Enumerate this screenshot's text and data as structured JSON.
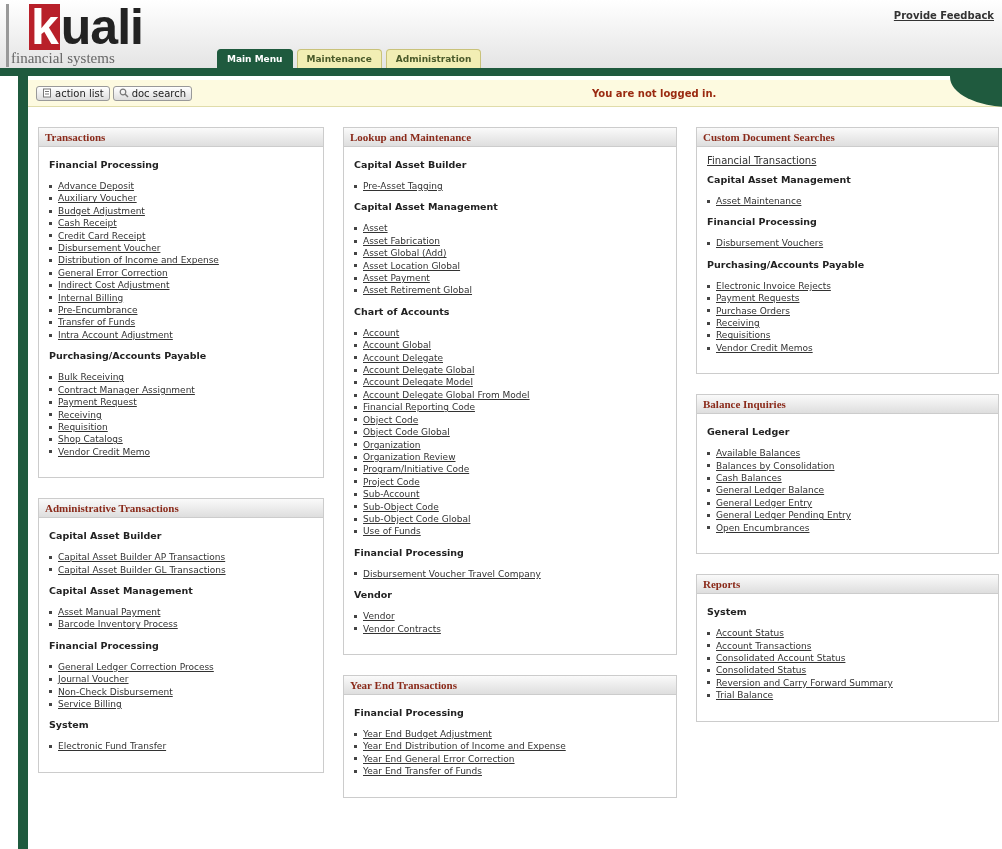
{
  "header": {
    "logo": "kuali",
    "tagline": "financial systems",
    "feedback_link": "Provide Feedback"
  },
  "tabs": [
    {
      "label": "Main Menu",
      "selected": true
    },
    {
      "label": "Maintenance",
      "selected": false
    },
    {
      "label": "Administration",
      "selected": false
    }
  ],
  "toolbar": {
    "buttons": [
      {
        "label": "action list",
        "kind": "list"
      },
      {
        "label": "doc search",
        "kind": "search"
      }
    ],
    "login_status": "You are not logged in."
  },
  "columns": [
    [
      {
        "title": "Transactions",
        "blocks": [
          {
            "kind": "section",
            "heading": "Financial Processing",
            "items": [
              "Advance Deposit",
              "Auxiliary Voucher",
              "Budget Adjustment",
              "Cash Receipt",
              "Credit Card Receipt",
              "Disbursement Voucher",
              "Distribution of Income and Expense",
              "General Error Correction",
              "Indirect Cost Adjustment",
              "Internal Billing",
              "Pre-Encumbrance",
              "Transfer of Funds",
              "Intra Account Adjustment"
            ]
          },
          {
            "kind": "section",
            "heading": "Purchasing/Accounts Payable",
            "items": [
              "Bulk Receiving",
              "Contract Manager Assignment",
              "Payment Request",
              "Receiving",
              "Requisition",
              "Shop Catalogs",
              "Vendor Credit Memo"
            ]
          }
        ]
      },
      {
        "title": "Administrative Transactions",
        "blocks": [
          {
            "kind": "section",
            "heading": "Capital Asset Builder",
            "items": [
              "Capital Asset Builder AP Transactions",
              "Capital Asset Builder GL Transactions"
            ]
          },
          {
            "kind": "section",
            "heading": "Capital Asset Management",
            "items": [
              "Asset Manual Payment",
              "Barcode Inventory Process"
            ]
          },
          {
            "kind": "section",
            "heading": "Financial Processing",
            "items": [
              "General Ledger Correction Process",
              "Journal Voucher",
              "Non-Check Disbursement",
              "Service Billing"
            ]
          },
          {
            "kind": "section",
            "heading": "System",
            "items": [
              "Electronic Fund Transfer"
            ]
          }
        ]
      }
    ],
    [
      {
        "title": "Lookup and Maintenance",
        "blocks": [
          {
            "kind": "section",
            "heading": "Capital Asset Builder",
            "items": [
              "Pre-Asset Tagging"
            ]
          },
          {
            "kind": "section",
            "heading": "Capital Asset Management",
            "items": [
              "Asset",
              "Asset Fabrication",
              "Asset Global (Add)",
              "Asset Location Global",
              "Asset Payment",
              "Asset Retirement Global"
            ]
          },
          {
            "kind": "section",
            "heading": "Chart of Accounts",
            "items": [
              "Account",
              "Account Global",
              "Account Delegate",
              "Account Delegate Global",
              "Account Delegate Model",
              "Account Delegate Global From Model",
              "Financial Reporting Code",
              "Object Code",
              "Object Code Global",
              "Organization",
              "Organization Review",
              "Program/Initiative Code",
              "Project Code",
              "Sub-Account",
              "Sub-Object Code",
              "Sub-Object Code Global",
              "Use of Funds"
            ]
          },
          {
            "kind": "section",
            "heading": "Financial Processing",
            "items": [
              "Disbursement Voucher Travel Company"
            ]
          },
          {
            "kind": "section",
            "heading": "Vendor",
            "items": [
              "Vendor",
              "Vendor Contracts"
            ]
          }
        ]
      },
      {
        "title": "Year End Transactions",
        "blocks": [
          {
            "kind": "section",
            "heading": "Financial Processing",
            "items": [
              "Year End Budget Adjustment",
              "Year End Distribution of Income and Expense",
              "Year End General Error Correction",
              "Year End Transfer of Funds"
            ]
          }
        ]
      }
    ],
    [
      {
        "title": "Custom Document Searches",
        "blocks": [
          {
            "kind": "link",
            "text": "Financial Transactions"
          },
          {
            "kind": "section",
            "heading": "Capital Asset Management",
            "items": [
              "Asset Maintenance"
            ]
          },
          {
            "kind": "section",
            "heading": "Financial Processing",
            "items": [
              "Disbursement Vouchers"
            ]
          },
          {
            "kind": "section",
            "heading": "Purchasing/Accounts Payable",
            "items": [
              "Electronic Invoice Rejects",
              "Payment Requests",
              "Purchase Orders",
              "Receiving",
              "Requisitions",
              "Vendor Credit Memos"
            ]
          }
        ]
      },
      {
        "title": "Balance Inquiries",
        "blocks": [
          {
            "kind": "section",
            "heading": "General Ledger",
            "items": [
              "Available Balances",
              "Balances by Consolidation",
              "Cash Balances",
              "General Ledger Balance",
              "General Ledger Entry",
              "General Ledger Pending Entry",
              "Open Encumbrances"
            ]
          }
        ]
      },
      {
        "title": "Reports",
        "blocks": [
          {
            "kind": "section",
            "heading": "System",
            "items": [
              "Account Status",
              "Account Transactions",
              "Consolidated Account Status",
              "Consolidated Status",
              "Reversion and Carry Forward Summary",
              "Trial Balance"
            ]
          }
        ]
      }
    ]
  ]
}
